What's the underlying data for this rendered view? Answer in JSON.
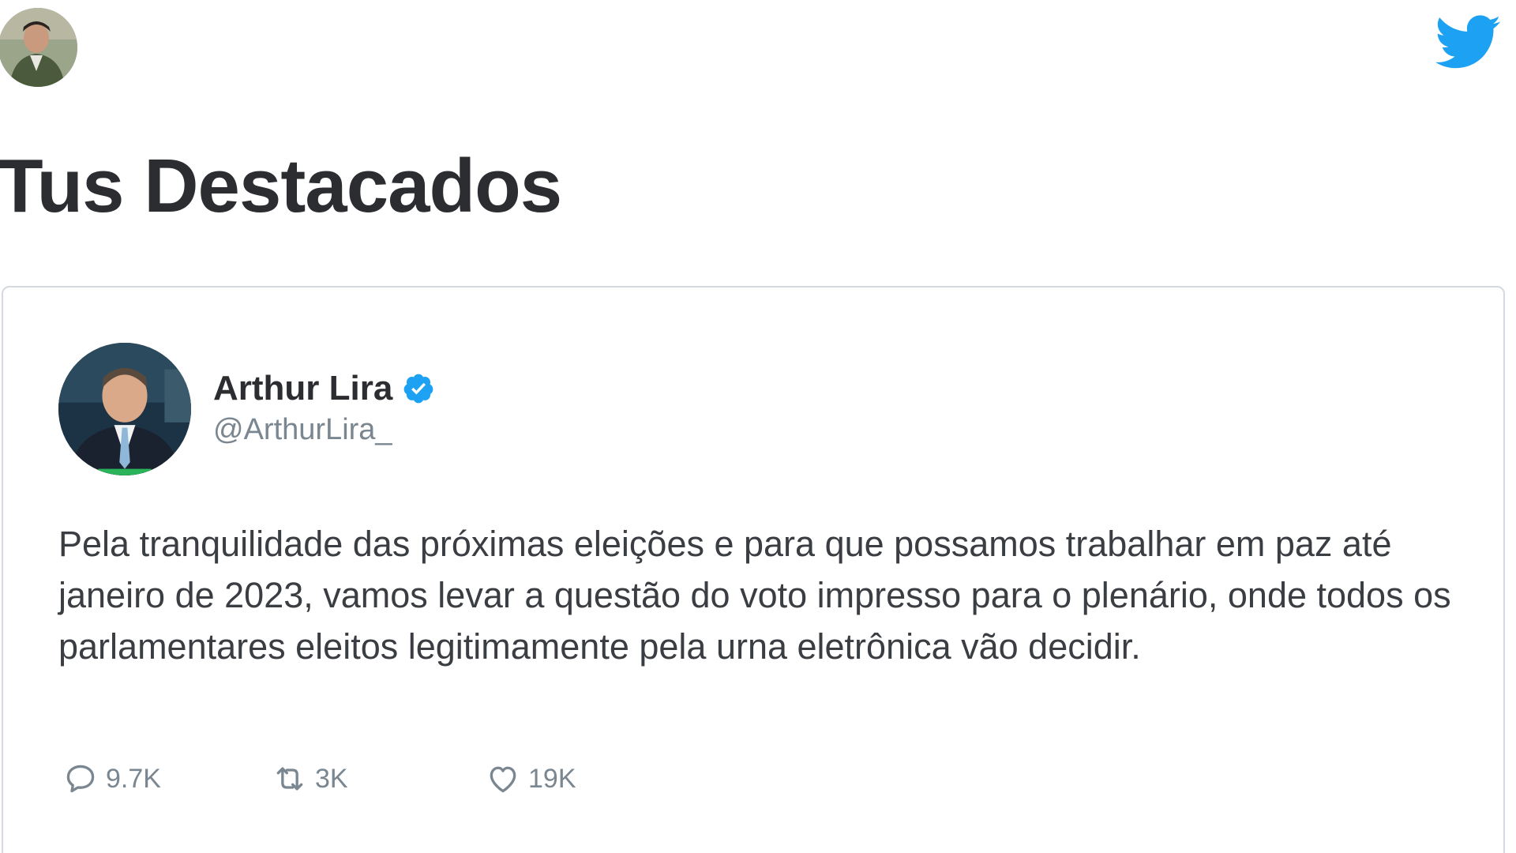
{
  "header": {
    "user_avatar_icon": "user-avatar",
    "brand_icon": "twitter-bird-icon",
    "brand_color": "#1da1f2"
  },
  "page": {
    "title": "Tus Destacados"
  },
  "tweet": {
    "author_name": "Arthur Lira",
    "author_handle": "@ArthurLira_",
    "verified_icon": "verified-badge-icon",
    "verified_color": "#1da1f2",
    "text": "Pela tranquilidade das próximas eleições e para que possamos trabalhar em paz até janeiro de 2023, vamos levar a questão do voto impresso para o plenário, onde todos os parlamentares eleitos legitimamente pela urna eletrônica vão decidir.",
    "actions": {
      "reply_count": "9.7K",
      "retweet_count": "3K",
      "like_count": "19K"
    }
  }
}
